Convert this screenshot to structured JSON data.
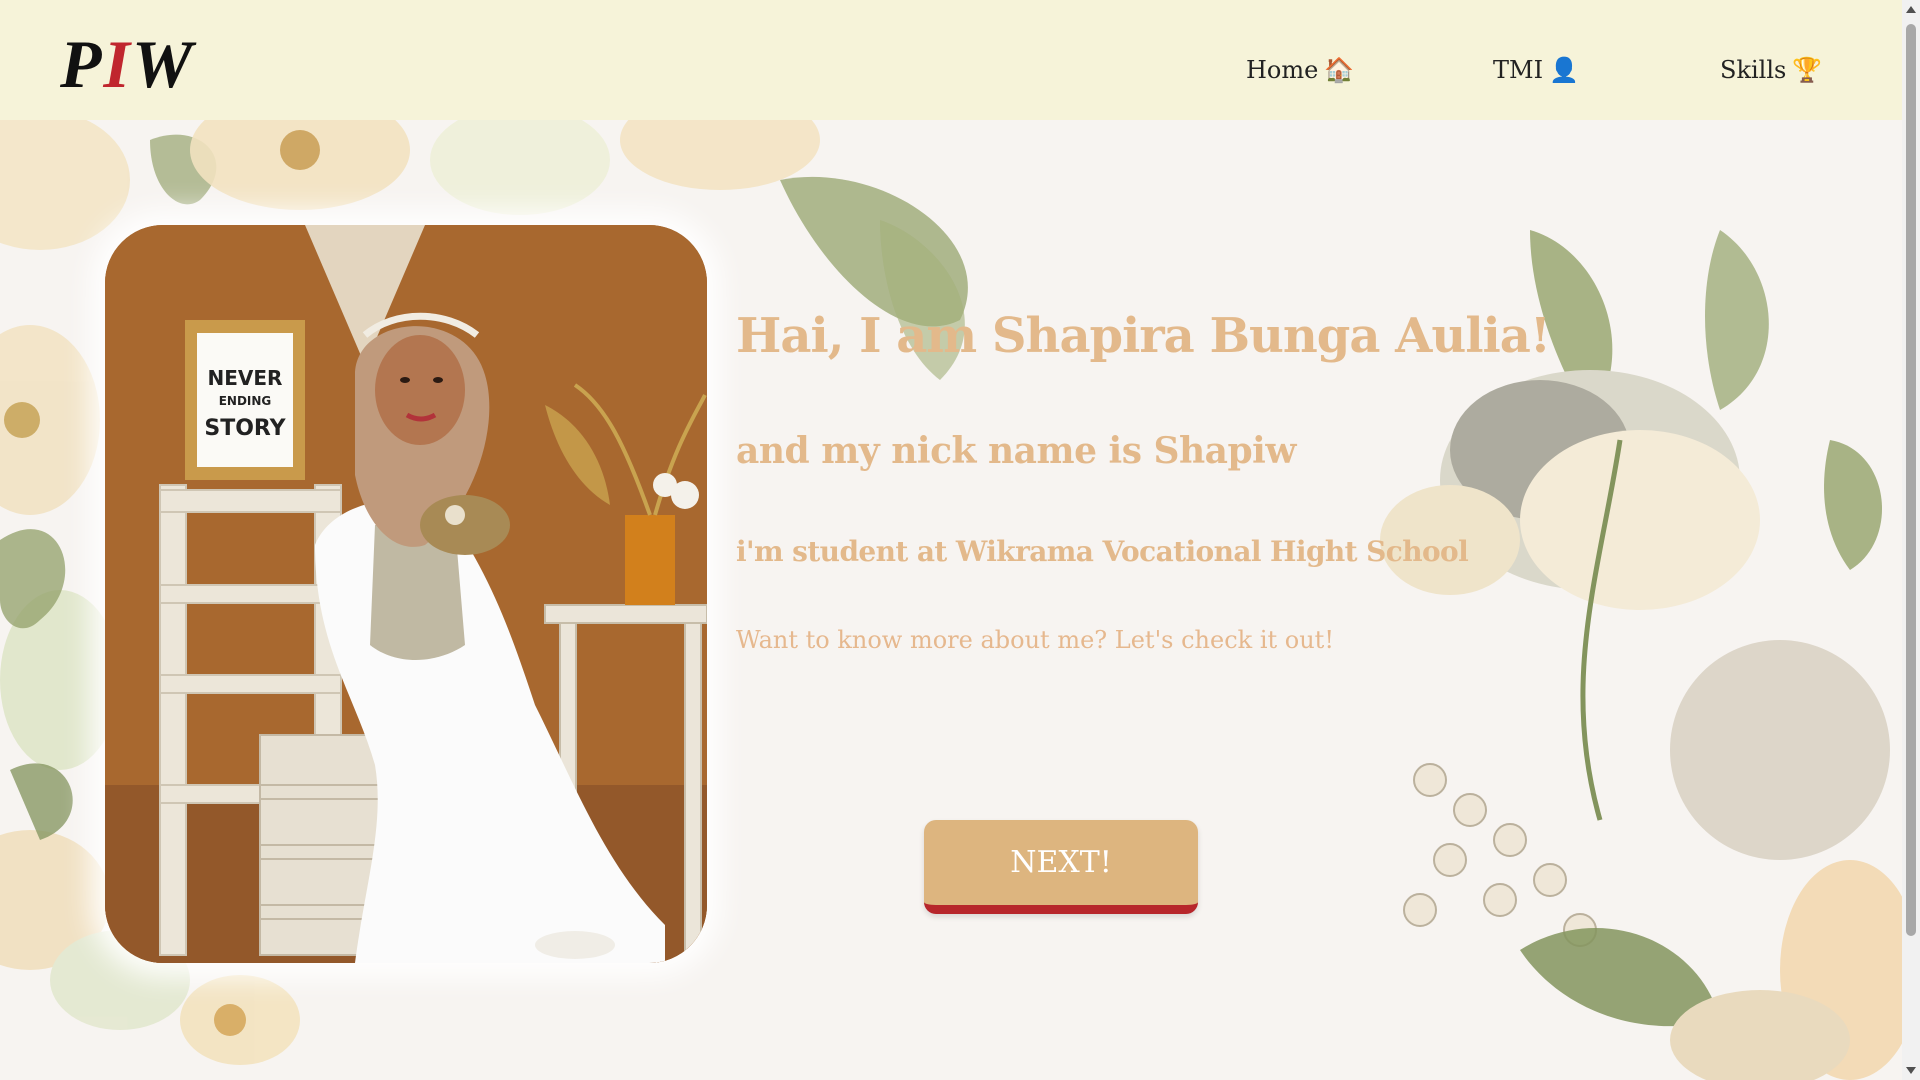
{
  "nav": {
    "logo_left": "P",
    "logo_mid": "I",
    "logo_right": "W",
    "items": [
      {
        "label": "Home",
        "icon": "house-icon",
        "emoji": "🏠"
      },
      {
        "label": "TMI",
        "icon": "person-icon",
        "emoji": "👤"
      },
      {
        "label": "Skills",
        "icon": "trophy-icon",
        "emoji": "🏆"
      }
    ]
  },
  "hero": {
    "headline": "Hai, I am Shapira Bunga Aulia!",
    "nick": "and my nick name is Shapiw",
    "school": "i'm student at Wikrama Vocational Hight School",
    "invite": "Want to know more about me? Let's check it out!",
    "button_label": "NEXT!",
    "photo_sign_line1": "NEVER",
    "photo_sign_line2": "ENDING",
    "photo_sign_line3": "STORY"
  },
  "colors": {
    "nav_bg": "#f6f3d9",
    "page_bg": "#f7f4f1",
    "text_accent": "#e3b98b",
    "button_bg": "#ddb57f",
    "button_border": "#b7262b",
    "logo_accent": "#c0262e"
  }
}
